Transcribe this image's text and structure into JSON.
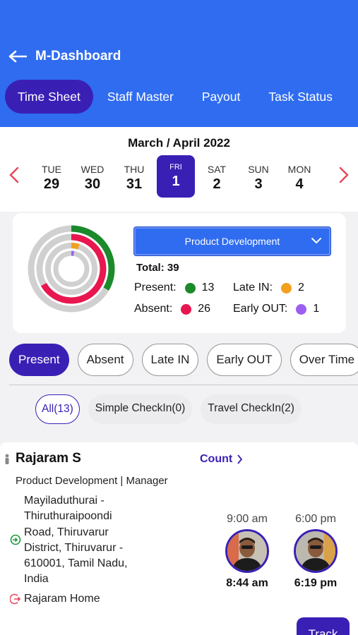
{
  "header": {
    "title": "M-Dashboard",
    "back_icon": "arrow-left-icon",
    "bg_color": "#2f6cf0",
    "accent_color": "#3a1fb5"
  },
  "tabs": [
    {
      "label": "Time Sheet",
      "active": true
    },
    {
      "label": "Staff Master",
      "active": false
    },
    {
      "label": "Payout",
      "active": false
    },
    {
      "label": "Task Status",
      "active": false
    }
  ],
  "calendar": {
    "month_label": "March / April 2022",
    "days": [
      {
        "name": "TUE",
        "date": "29"
      },
      {
        "name": "WED",
        "date": "30"
      },
      {
        "name": "THU",
        "date": "31"
      },
      {
        "name": "FRI",
        "date": "1",
        "selected": true
      },
      {
        "name": "SAT",
        "date": "2"
      },
      {
        "name": "SUN",
        "date": "3"
      },
      {
        "name": "MON",
        "date": "4"
      }
    ]
  },
  "summary": {
    "department": "Product Development",
    "total_label": "Total: 39",
    "stats": [
      {
        "label": "Present:",
        "value": "13",
        "color": "#1a8a2a"
      },
      {
        "label": "Late IN:",
        "value": "2",
        "color": "#f2a01e"
      },
      {
        "label": "Absent:",
        "value": "26",
        "color": "#e8174f"
      },
      {
        "label": "Early OUT:",
        "value": "1",
        "color": "#9b5ff0"
      }
    ],
    "rings": {
      "present": 13,
      "absent": 26,
      "late_in": 2,
      "early_out": 1,
      "total": 39
    }
  },
  "filters": [
    {
      "label": "Present",
      "active": true
    },
    {
      "label": "Absent",
      "active": false
    },
    {
      "label": "Late IN",
      "active": false
    },
    {
      "label": "Early OUT",
      "active": false
    },
    {
      "label": "Over Time",
      "active": false
    }
  ],
  "sub_filters": [
    {
      "label": "All(13)",
      "active": true
    },
    {
      "label": "Simple CheckIn(0)",
      "active": false
    },
    {
      "label": "Travel CheckIn(2)",
      "active": false
    }
  ],
  "employee": {
    "name": "Rajaram S",
    "count_label": "Count",
    "role": "Product Development | Manager",
    "address_lines": [
      "Mayiladuthurai -",
      "Thiruthuraipoondi",
      "Road, Thiruvarur",
      "District, Thiruvarur -",
      "610001, Tamil Nadu,",
      "India"
    ],
    "location": "Rajaram Home",
    "check_in": {
      "scheduled": "9:00 am",
      "actual": "8:44 am"
    },
    "check_out": {
      "scheduled": "6:00 pm",
      "actual": "6:19 pm"
    },
    "track_label": "Track"
  }
}
